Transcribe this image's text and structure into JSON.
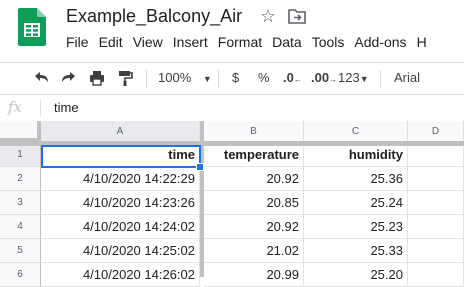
{
  "document": {
    "title": "Example_Balcony_Air"
  },
  "menu": [
    "File",
    "Edit",
    "View",
    "Insert",
    "Format",
    "Data",
    "Tools",
    "Add-ons",
    "H"
  ],
  "toolbar": {
    "zoom": "100%",
    "currency": "$",
    "percent": "%",
    "decrease_decimal": ".0",
    "increase_decimal": ".00",
    "more_formats": "123",
    "font": "Arial"
  },
  "formula_bar": {
    "fx": "fx",
    "value": "time"
  },
  "columns": [
    "A",
    "B",
    "C",
    "D"
  ],
  "rows": [
    {
      "num": "1",
      "a": "time",
      "b": "temperature",
      "c": "humidity"
    },
    {
      "num": "2",
      "a": "4/10/2020 14:22:29",
      "b": "20.92",
      "c": "25.36"
    },
    {
      "num": "3",
      "a": "4/10/2020 14:23:26",
      "b": "20.85",
      "c": "25.24"
    },
    {
      "num": "4",
      "a": "4/10/2020 14:24:02",
      "b": "20.92",
      "c": "25.23"
    },
    {
      "num": "5",
      "a": "4/10/2020 14:25:02",
      "b": "21.02",
      "c": "25.33"
    },
    {
      "num": "6",
      "a": "4/10/2020 14:26:02",
      "b": "20.99",
      "c": "25.20"
    }
  ],
  "colors": {
    "accent": "#1a73e8",
    "sheets_green": "#0f9d58"
  }
}
